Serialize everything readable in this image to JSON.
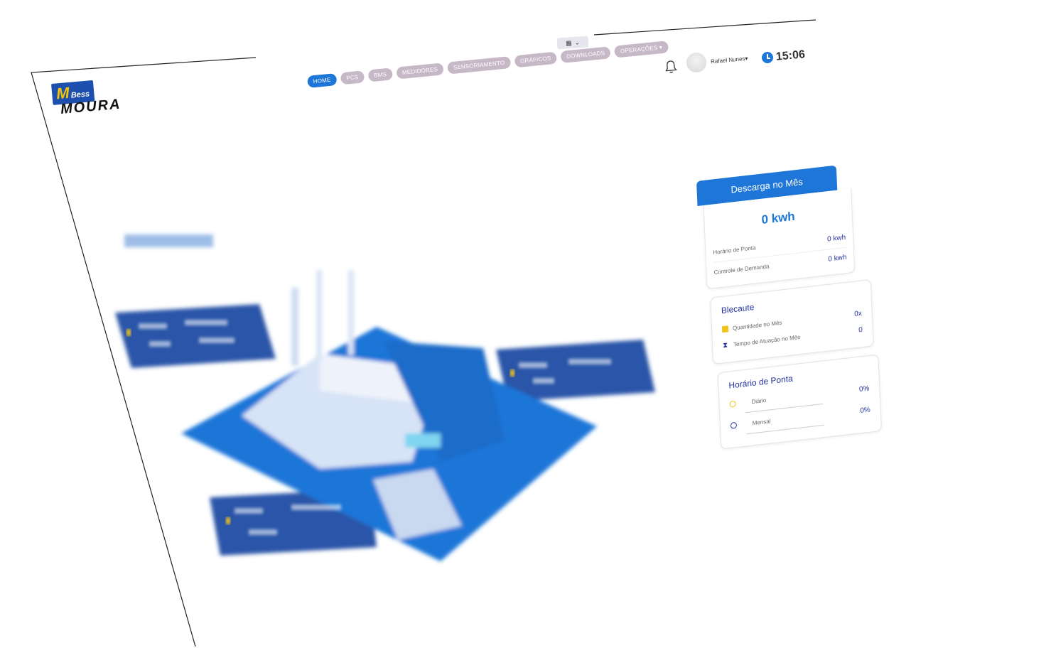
{
  "logo": {
    "mark": "M",
    "sub": "Bess",
    "word": "MOURA"
  },
  "nav": {
    "items": [
      {
        "label": "HOME",
        "active": true
      },
      {
        "label": "PCS",
        "active": false
      },
      {
        "label": "BMS",
        "active": false
      },
      {
        "label": "MEDIDORES",
        "active": false
      },
      {
        "label": "SENSORIAMENTO",
        "active": false
      },
      {
        "label": "GRÁFICOS",
        "active": false
      },
      {
        "label": "DOWNLOADS",
        "active": false
      },
      {
        "label": "OPERAÇÕES ▾",
        "active": false
      }
    ]
  },
  "header": {
    "user_name": "Rafael Nunes▾",
    "time": "15:06"
  },
  "descarga": {
    "title": "Descarga no Mês",
    "total": "0 kwh",
    "rows": [
      {
        "label": "Horário de Ponta",
        "value": "0 kwh"
      },
      {
        "label": "Controle de Demanda",
        "value": "0 kwh"
      }
    ]
  },
  "blecaute": {
    "title": "Blecaute",
    "rows": [
      {
        "icon": "calendar-icon",
        "label": "Quantidade no Mês",
        "value": "0x"
      },
      {
        "icon": "hourglass-icon",
        "label": "Tempo de Atuação no Mês",
        "value": "0"
      }
    ]
  },
  "ponta": {
    "title": "Horário de Ponta",
    "rows": [
      {
        "icon": "sun-icon",
        "label": "Diário",
        "value": "0%"
      },
      {
        "icon": "clock-icon",
        "label": "Mensal",
        "value": "0%"
      }
    ]
  },
  "colors": {
    "accent": "#1d76d8",
    "nav_inactive": "#c7b8c8",
    "text_value": "#2433a0",
    "brand_yellow": "#f5c400"
  }
}
